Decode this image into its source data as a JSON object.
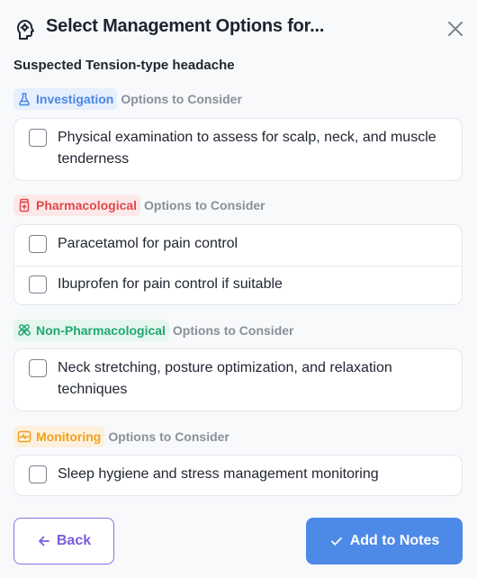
{
  "header": {
    "title": "Select Management Options for...",
    "icon": "brain-head-icon",
    "close_icon": "close-icon"
  },
  "subtitle": "Suspected Tension-type headache",
  "sections": {
    "investigation": {
      "label": "Investigation",
      "suffix": "Options to Consider",
      "color": "#4b86e6",
      "icon": "flask-icon",
      "options": [
        "Physical examination to assess for scalp, neck, and muscle tenderness"
      ]
    },
    "pharmacological": {
      "label": "Pharmacological",
      "suffix": "Options to Consider",
      "color": "#e0484d",
      "icon": "pill-bottle-icon",
      "options": [
        "Paracetamol for pain control",
        "Ibuprofen for pain control if suitable"
      ]
    },
    "non_pharmacological": {
      "label": "Non-Pharmacological",
      "suffix": "Options to Consider",
      "color": "#1fa870",
      "icon": "bandage-icon",
      "options": [
        "Neck stretching, posture optimization, and relaxation techniques"
      ]
    },
    "monitoring": {
      "label": "Monitoring",
      "suffix": "Options to Consider",
      "color": "#f0a020",
      "icon": "activity-monitor-icon",
      "options": [
        "Sleep hygiene and stress management monitoring"
      ]
    }
  },
  "footer": {
    "back_label": "Back",
    "add_label": "Add to Notes",
    "accent_back": "#7a5ce0",
    "accent_add": "#4d8ae8"
  }
}
